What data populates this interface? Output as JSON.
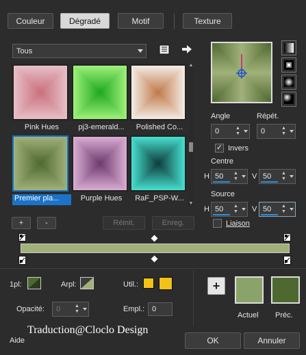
{
  "tabs": [
    {
      "label": "Couleur"
    },
    {
      "label": "Dégradé",
      "active": true
    },
    {
      "label": "Motif"
    },
    {
      "label": "Texture"
    }
  ],
  "category": {
    "value": "Tous"
  },
  "gradients": [
    {
      "label": "Pink Hues",
      "colors": [
        "#c9707c",
        "#e8c0c8"
      ]
    },
    {
      "label": "pj3-emerald...",
      "colors": [
        "#1fa81f",
        "#9ff07a"
      ]
    },
    {
      "label": "Polished Co...",
      "colors": [
        "#c07a4a",
        "#f4ece6"
      ]
    },
    {
      "label": "Premier pla...",
      "colors": [
        "#4e6930",
        "#a1b17a"
      ],
      "selected": true
    },
    {
      "label": "Purple Hues",
      "colors": [
        "#6e3a6e",
        "#d9aed3"
      ]
    },
    {
      "label": "RaF_PSP-W...",
      "colors": [
        "#0f3b3b",
        "#47e0cf"
      ]
    }
  ],
  "angle": {
    "label": "Angle",
    "value": "0"
  },
  "repeat": {
    "label": "Répét.",
    "value": "0"
  },
  "invert": {
    "label": "Invers",
    "checked": true
  },
  "center": {
    "label": "Centre",
    "h_label": "H",
    "h_value": "50",
    "v_label": "V",
    "v_value": "50"
  },
  "source": {
    "label": "Source",
    "h_label": "H",
    "h_value": "50",
    "v_label": "V",
    "v_value": "50"
  },
  "link": {
    "label": "Liaison",
    "checked": false
  },
  "list_buttons": {
    "add": "+",
    "remove": "-",
    "reset": "Réinit.",
    "save": "Enreg."
  },
  "bottom": {
    "fg_label": "1pl:",
    "bg_label": "Arpl:",
    "user_label": "Util.:",
    "opacity_label": "Opacité:",
    "opacity_value": "0",
    "location_label": "Empl.:",
    "location_value": "0",
    "user_color": "#f2c21a",
    "current_label": "Actuel",
    "previous_label": "Préc.",
    "current_color": "#8aa36a",
    "previous_color": "#4e6930"
  },
  "watermark": "Traduction@Cloclo Design",
  "footer": {
    "help": "Aide",
    "ok": "OK",
    "cancel": "Annuler"
  },
  "colors": {
    "dark_green": "#4e6930",
    "light_green": "#a1b17a",
    "accent_blue": "#1a73c8"
  }
}
